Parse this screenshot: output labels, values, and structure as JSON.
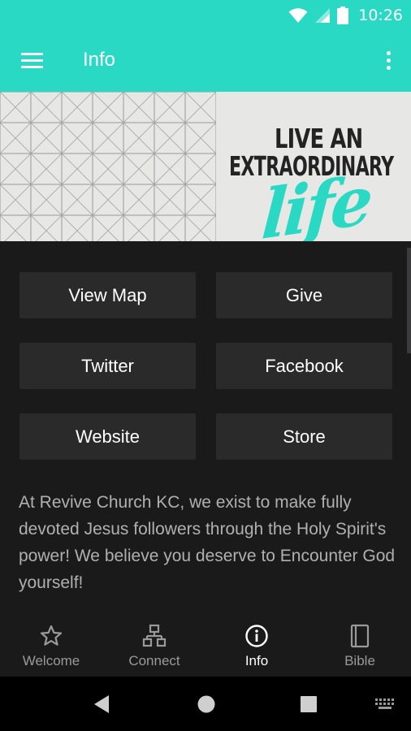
{
  "status_bar": {
    "time": "10:26"
  },
  "app_bar": {
    "title": "Info"
  },
  "hero": {
    "line1": "LIVE AN",
    "line2": "EXTRAORDINARY",
    "script": "life"
  },
  "buttons": [
    {
      "label": "View Map"
    },
    {
      "label": "Give"
    },
    {
      "label": "Twitter"
    },
    {
      "label": "Facebook"
    },
    {
      "label": "Website"
    },
    {
      "label": "Store"
    }
  ],
  "description": "At Revive Church KC, we exist to make fully devoted Jesus followers through the Holy Spirit's power!  We believe you deserve to Encounter God yourself!",
  "bottom_nav": {
    "items": [
      {
        "label": "Welcome",
        "icon": "star-icon",
        "active": false
      },
      {
        "label": "Connect",
        "icon": "org-chart-icon",
        "active": false
      },
      {
        "label": "Info",
        "icon": "info-icon",
        "active": true
      },
      {
        "label": "Bible",
        "icon": "book-icon",
        "active": false
      }
    ]
  },
  "colors": {
    "accent": "#2ad9c4",
    "background": "#1a1a1b",
    "button": "#2a2a2b"
  }
}
